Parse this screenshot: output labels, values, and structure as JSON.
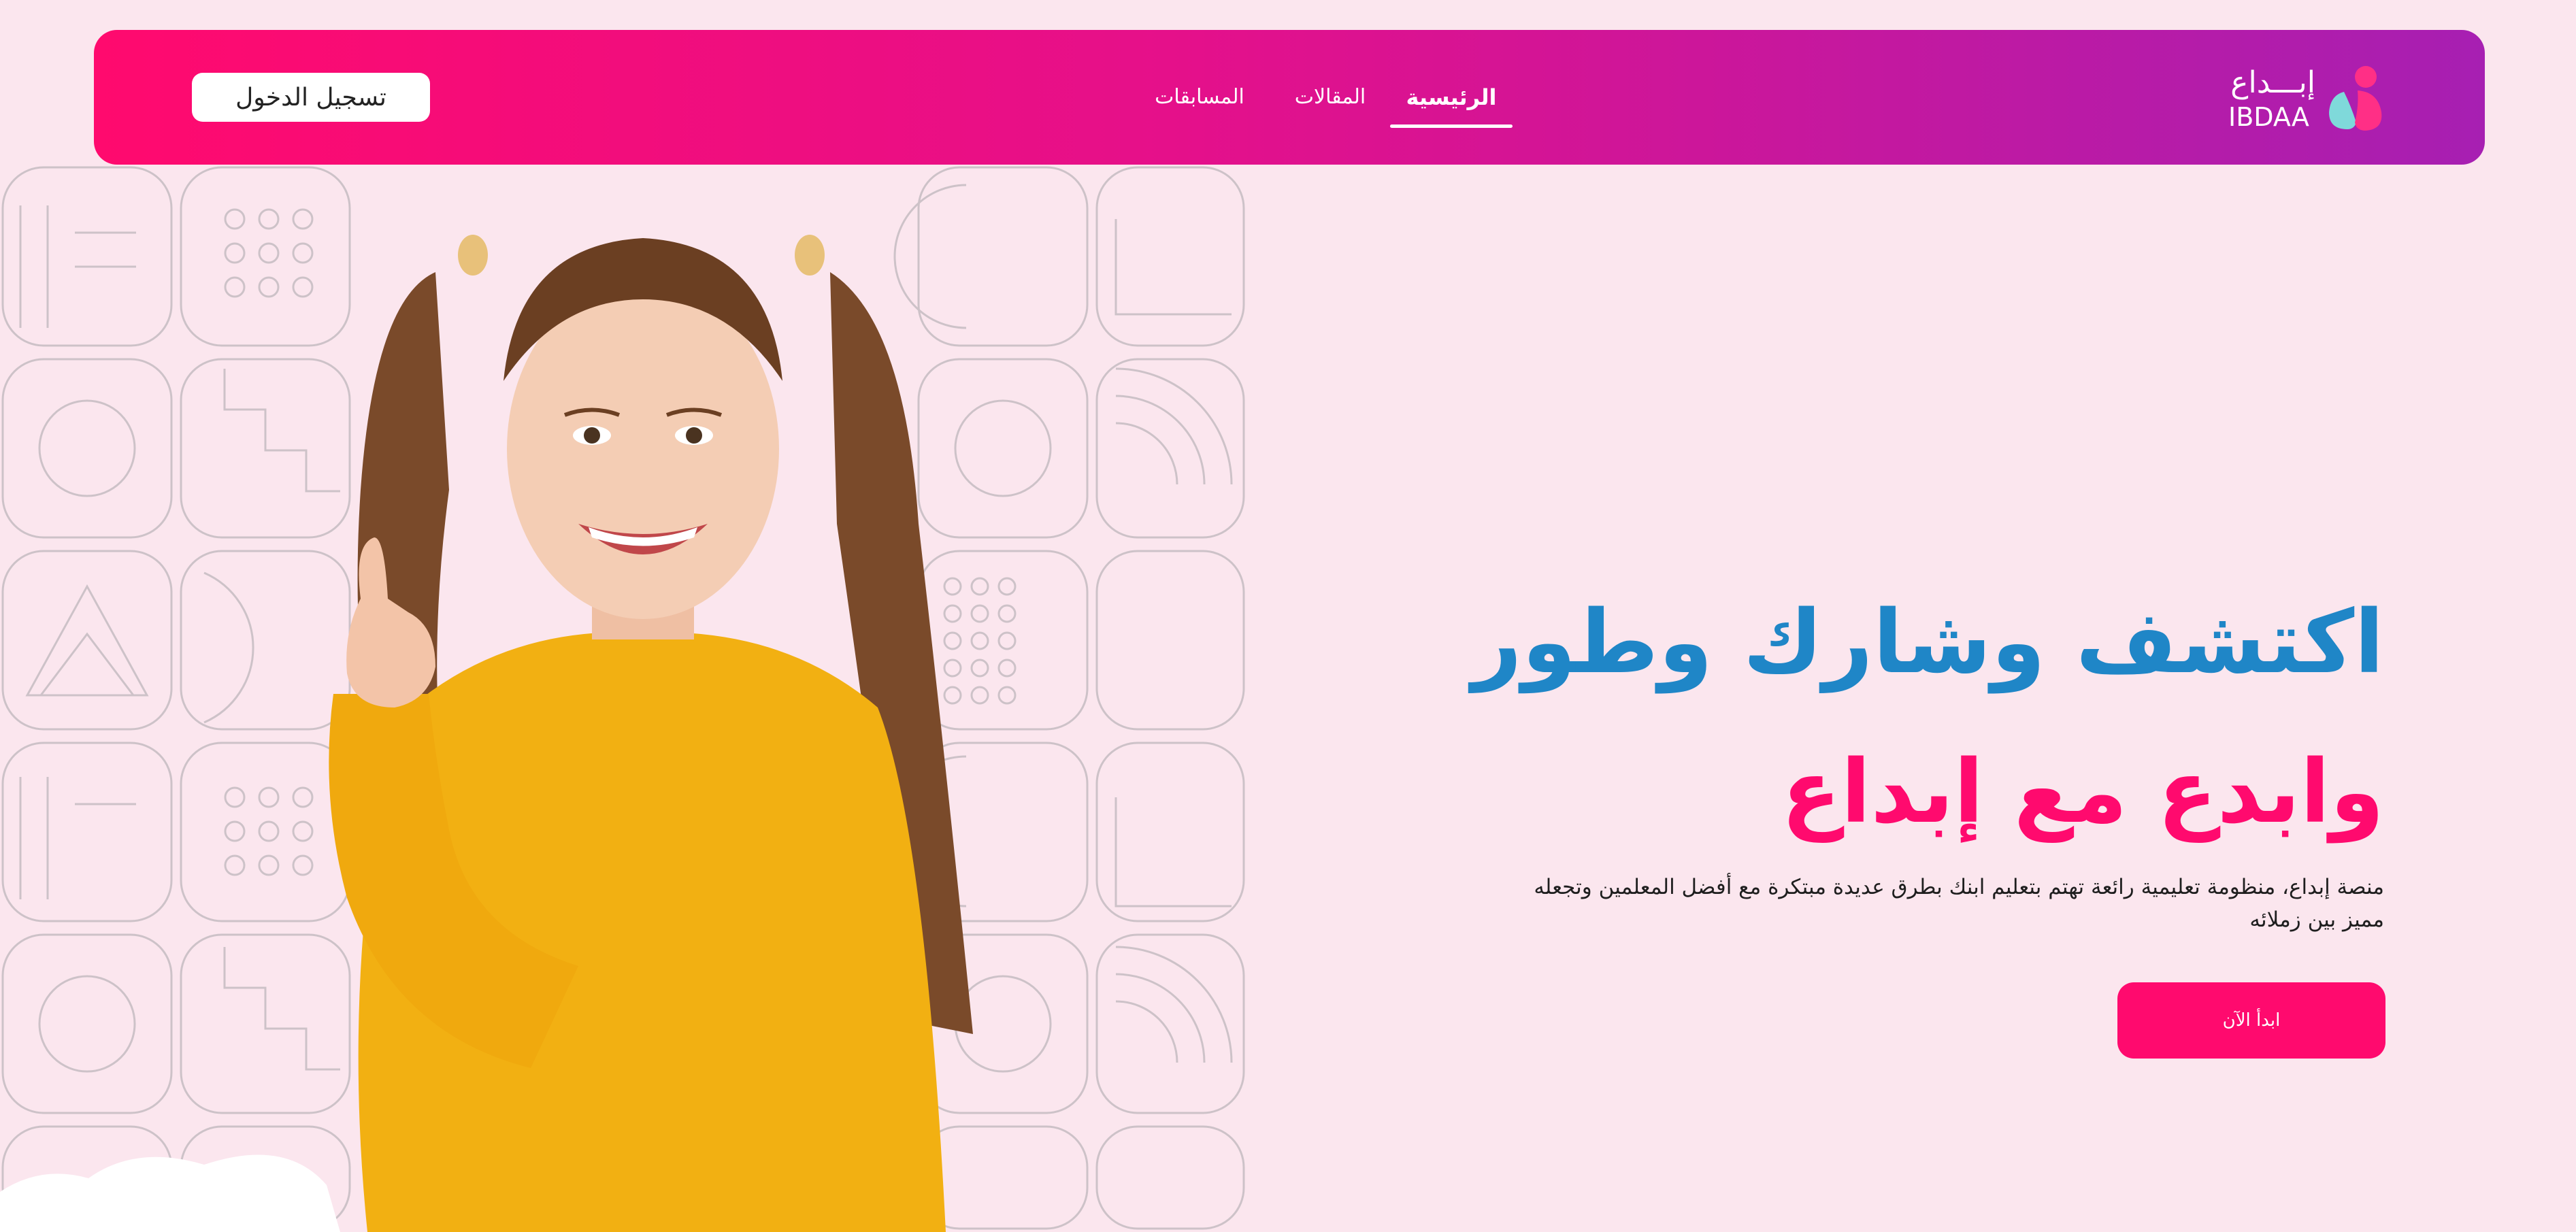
{
  "nav": {
    "login_label": "تسجيل الدخول",
    "links": [
      {
        "label": "الرئيسية",
        "active": true
      },
      {
        "label": "المقالات",
        "active": false
      },
      {
        "label": "المسابقات",
        "active": false
      }
    ]
  },
  "logo": {
    "arabic": "إبـــداع",
    "latin": "IBDAA"
  },
  "hero": {
    "headline_line1": "اكتشف وشارك وطور",
    "headline_line2": "وابدع مع إبداع",
    "description": "منصة إبداع، منظومة تعليمية رائعة تهتم بتعليم ابنك بطرق عديدة مبتكرة مع أفضل المعلمين وتجعله مميز بين زملائه",
    "cta_label": "ابدأ الآن"
  },
  "colors": {
    "page_background": "#fbe6ee",
    "navbar_gradient_start": "#ff0a6e",
    "navbar_gradient_end": "#a71fb2",
    "headline_blue": "#1f86c7",
    "brand_pink": "#ff0a6e",
    "logo_teal": "#7fd9da"
  },
  "icons": {
    "logo_mark": "ibdaa-logo-icon"
  }
}
